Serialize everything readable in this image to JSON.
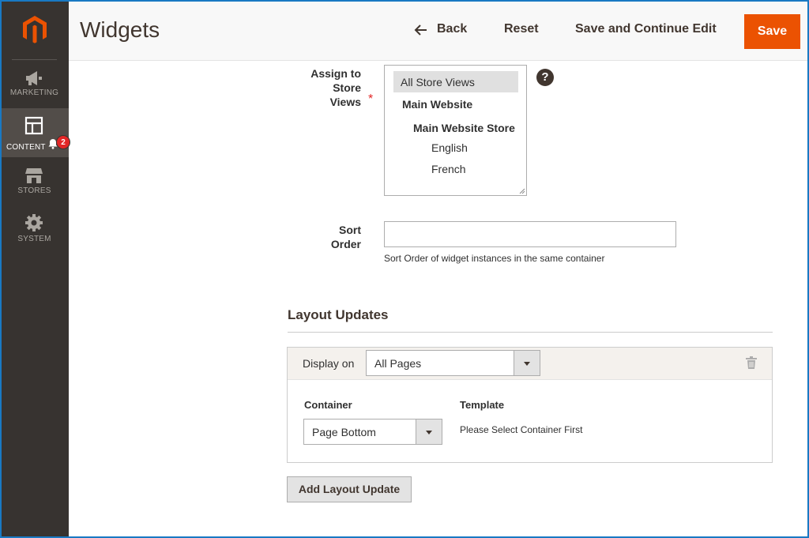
{
  "sidebar": {
    "items": [
      {
        "label": "MARKETING",
        "icon": "megaphone-icon"
      },
      {
        "label": "CONTENT",
        "icon": "layout-icon",
        "active": true,
        "badge": "2"
      },
      {
        "label": "STORES",
        "icon": "store-icon"
      },
      {
        "label": "SYSTEM",
        "icon": "gear-icon"
      }
    ]
  },
  "header": {
    "title": "Widgets",
    "back_label": "Back",
    "reset_label": "Reset",
    "save_continue_label": "Save and Continue Edit",
    "save_label": "Save"
  },
  "form": {
    "store_views": {
      "label_lines": [
        "Assign to",
        "Store",
        "Views"
      ],
      "options": {
        "all": "All Store Views",
        "website": "Main Website",
        "store": "Main Website Store",
        "english": "English",
        "french": "French"
      },
      "help": "?"
    },
    "sort_order": {
      "label_lines": [
        "Sort",
        "Order"
      ],
      "value": "",
      "note": "Sort Order of widget instances in the same container"
    }
  },
  "layout_updates": {
    "title": "Layout Updates",
    "display_on_label": "Display on",
    "display_on_value": "All Pages",
    "container_label": "Container",
    "container_value": "Page Bottom",
    "template_label": "Template",
    "template_value": "Please Select Container First",
    "add_button": "Add Layout Update"
  },
  "colors": {
    "accent": "#eb5202",
    "sidebar": "#373330",
    "badge": "#e22626"
  }
}
